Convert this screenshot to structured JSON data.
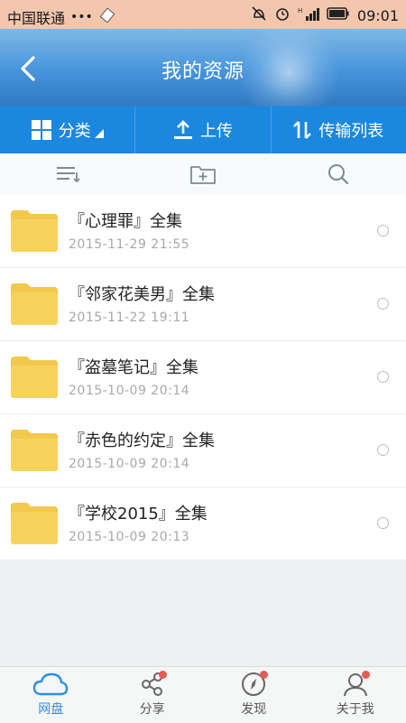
{
  "status_bar": {
    "carrier": "中国联通",
    "dots": "•••",
    "time": "09:01"
  },
  "header": {
    "title": "我的资源",
    "back_icon": "chevron-left-icon"
  },
  "toolbar": {
    "category_label": "分类",
    "upload_label": "上传",
    "transfer_label": "传输列表"
  },
  "subbar": {
    "icons": [
      "sort-list-icon",
      "new-folder-icon",
      "search-icon"
    ]
  },
  "files": [
    {
      "name": "『心理罪』全集",
      "date": "2015-11-29  21:55"
    },
    {
      "name": "『邻家花美男』全集",
      "date": "2015-11-22  19:11"
    },
    {
      "name": "『盗墓笔记』全集",
      "date": "2015-10-09  20:14"
    },
    {
      "name": "『赤色的约定』全集",
      "date": "2015-10-09  20:14"
    },
    {
      "name": "『学校2015』全集",
      "date": "2015-10-09  20:13"
    }
  ],
  "bottom_nav": {
    "items": [
      {
        "label": "网盘",
        "icon": "cloud-icon",
        "active": true
      },
      {
        "label": "分享",
        "icon": "share-icon",
        "badge": true
      },
      {
        "label": "发现",
        "icon": "compass-icon",
        "badge": true
      },
      {
        "label": "关于我",
        "icon": "person-icon",
        "badge": true
      }
    ]
  },
  "colors": {
    "accent": "#1b87df",
    "folder": "#f2c94c",
    "badge": "#e65a52"
  }
}
